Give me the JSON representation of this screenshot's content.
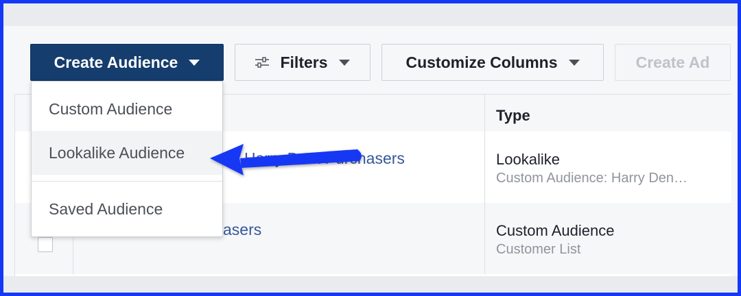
{
  "toolbar": {
    "create_audience_label": "Create Audience",
    "filters_label": "Filters",
    "customize_columns_label": "Customize Columns",
    "create_ad_label": "Create Ad"
  },
  "dropdown": {
    "items": [
      {
        "label": "Custom Audience"
      },
      {
        "label": "Lookalike Audience",
        "highlighted": true
      },
      {
        "label": "Saved Audience"
      }
    ]
  },
  "table": {
    "type_header": "Type",
    "rows": [
      {
        "name": "Harry Dent Purchasers",
        "type": "Lookalike",
        "type_detail": "Custom Audience: Harry Den…"
      },
      {
        "name": "asers",
        "type": "Custom Audience",
        "type_detail": "Customer List"
      }
    ]
  },
  "colors": {
    "primary_button": "#153d6d",
    "link": "#365899",
    "annotation_arrow": "#1438f5",
    "frame_border": "#1438f5"
  },
  "icons": {
    "filters": "sliders-icon",
    "caret": "caret-down-icon",
    "annotation": "pointer-arrow-icon"
  }
}
